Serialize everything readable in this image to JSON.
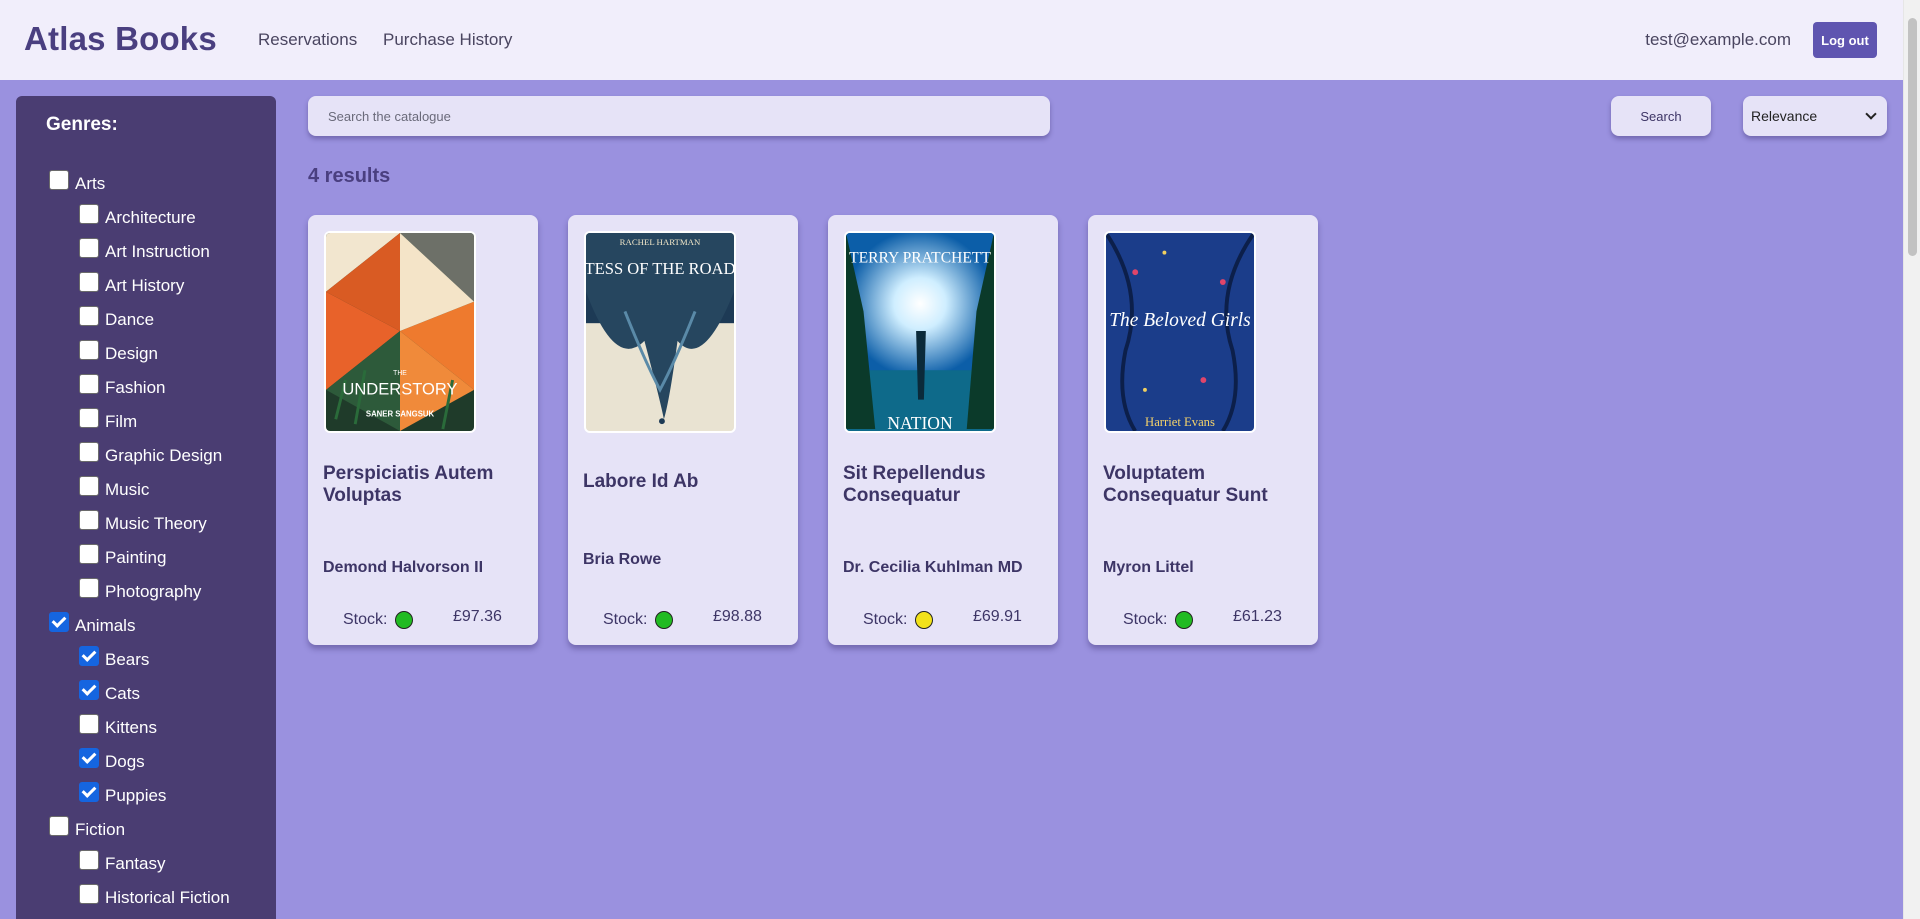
{
  "header": {
    "logo": "Atlas Books",
    "nav": [
      "Reservations",
      "Purchase History"
    ],
    "user_email": "test@example.com",
    "logout_label": "Log out"
  },
  "sidebar": {
    "title": "Genres:",
    "genres": [
      {
        "label": "Arts",
        "checked": false,
        "level": 0
      },
      {
        "label": "Architecture",
        "checked": false,
        "level": 1
      },
      {
        "label": "Art Instruction",
        "checked": false,
        "level": 1
      },
      {
        "label": "Art History",
        "checked": false,
        "level": 1
      },
      {
        "label": "Dance",
        "checked": false,
        "level": 1
      },
      {
        "label": "Design",
        "checked": false,
        "level": 1
      },
      {
        "label": "Fashion",
        "checked": false,
        "level": 1
      },
      {
        "label": "Film",
        "checked": false,
        "level": 1
      },
      {
        "label": "Graphic Design",
        "checked": false,
        "level": 1
      },
      {
        "label": "Music",
        "checked": false,
        "level": 1
      },
      {
        "label": "Music Theory",
        "checked": false,
        "level": 1
      },
      {
        "label": "Painting",
        "checked": false,
        "level": 1
      },
      {
        "label": "Photography",
        "checked": false,
        "level": 1
      },
      {
        "label": "Animals",
        "checked": true,
        "level": 0
      },
      {
        "label": "Bears",
        "checked": true,
        "level": 1
      },
      {
        "label": "Cats",
        "checked": true,
        "level": 1
      },
      {
        "label": "Kittens",
        "checked": false,
        "level": 1
      },
      {
        "label": "Dogs",
        "checked": true,
        "level": 1
      },
      {
        "label": "Puppies",
        "checked": true,
        "level": 1
      },
      {
        "label": "Fiction",
        "checked": false,
        "level": 0
      },
      {
        "label": "Fantasy",
        "checked": false,
        "level": 1
      },
      {
        "label": "Historical Fiction",
        "checked": false,
        "level": 1
      }
    ]
  },
  "search": {
    "placeholder": "Search the catalogue",
    "button_label": "Search",
    "sort_selected": "Relevance"
  },
  "results": {
    "count_label": "4 results",
    "books": [
      {
        "title": "Perspiciatis Autem Voluptas",
        "author": "Demond Halvorson II",
        "price": "£97.36",
        "stock_label": "Stock:",
        "stock_color": "#22bb22",
        "cover": {
          "text_top": "THE",
          "text_main": "UNDERSTORY",
          "text_bottom": "SANER SANGSUK"
        }
      },
      {
        "title": "Labore Id Ab",
        "author": "Bria Rowe",
        "price": "£98.88",
        "stock_label": "Stock:",
        "stock_color": "#22bb22",
        "cover": {
          "text_top": "RACHEL HARTMAN",
          "text_main": "TESS OF THE ROAD"
        }
      },
      {
        "title": "Sit Repellendus Consequatur",
        "author": "Dr. Cecilia Kuhlman MD",
        "price": "£69.91",
        "stock_label": "Stock:",
        "stock_color": "#f2e21a",
        "cover": {
          "text_top": "TERRY PRATCHETT",
          "text_main": "NATION"
        }
      },
      {
        "title": "Voluptatem Consequatur Sunt",
        "author": "Myron Littel",
        "price": "£61.23",
        "stock_label": "Stock:",
        "stock_color": "#22bb22",
        "cover": {
          "text_main": "The Beloved Girls",
          "text_bottom": "Harriet Evans"
        }
      }
    ]
  }
}
